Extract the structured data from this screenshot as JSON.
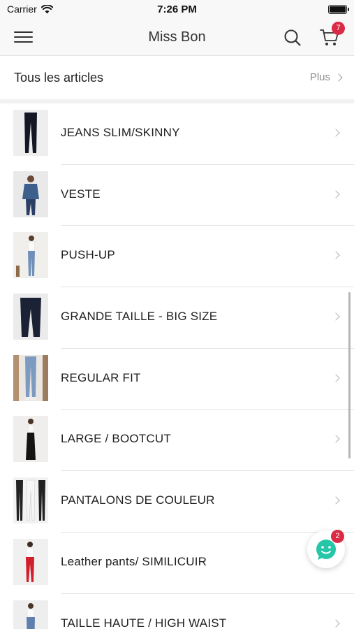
{
  "status_bar": {
    "carrier": "Carrier",
    "time": "7:26 PM",
    "icons": [
      "wifi-icon",
      "battery-icon"
    ]
  },
  "nav": {
    "title": "Miss Bon",
    "icons": [
      "menu-icon",
      "search-icon",
      "cart-icon"
    ],
    "cart_badge": "7"
  },
  "section": {
    "title": "Tous les articles",
    "more_label": "Plus"
  },
  "categories": [
    {
      "label": "JEANS SLIM/SKINNY"
    },
    {
      "label": "VESTE"
    },
    {
      "label": "PUSH-UP"
    },
    {
      "label": "GRANDE TAILLE - BIG SIZE"
    },
    {
      "label": "REGULAR FIT"
    },
    {
      "label": "LARGE / BOOTCUT"
    },
    {
      "label": "PANTALONS DE COULEUR"
    },
    {
      "label": "Leather pants/ SIMILICUIR"
    },
    {
      "label": "TAILLE HAUTE / HIGH WAIST"
    }
  ],
  "chat": {
    "icon": "chat-icon",
    "badge": "2"
  },
  "colors": {
    "badge": "#d92b45",
    "chat_accent": "#26c6a8",
    "nav_background": "#f8f8f8"
  }
}
